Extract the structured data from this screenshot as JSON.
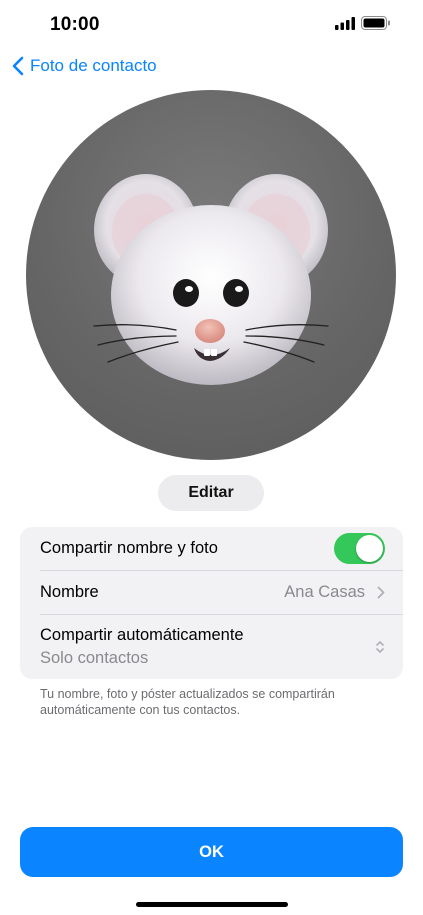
{
  "status_bar": {
    "time": "10:00"
  },
  "nav": {
    "back_label": "Foto de contacto"
  },
  "photo": {
    "subject": "mouse memoji"
  },
  "edit_button": {
    "label": "Editar"
  },
  "settings": {
    "share_name_photo": {
      "label": "Compartir nombre y foto",
      "enabled": true
    },
    "name": {
      "label": "Nombre",
      "value": "Ana Casas"
    },
    "auto_share": {
      "label": "Compartir automáticamente",
      "value": "Solo contactos"
    }
  },
  "footnote": "Tu nombre, foto y póster actualizados se compartirán automáticamente con tus contactos.",
  "ok_button": {
    "label": "OK"
  },
  "colors": {
    "accent": "#0a84ff",
    "toggle_on": "#34c759"
  }
}
